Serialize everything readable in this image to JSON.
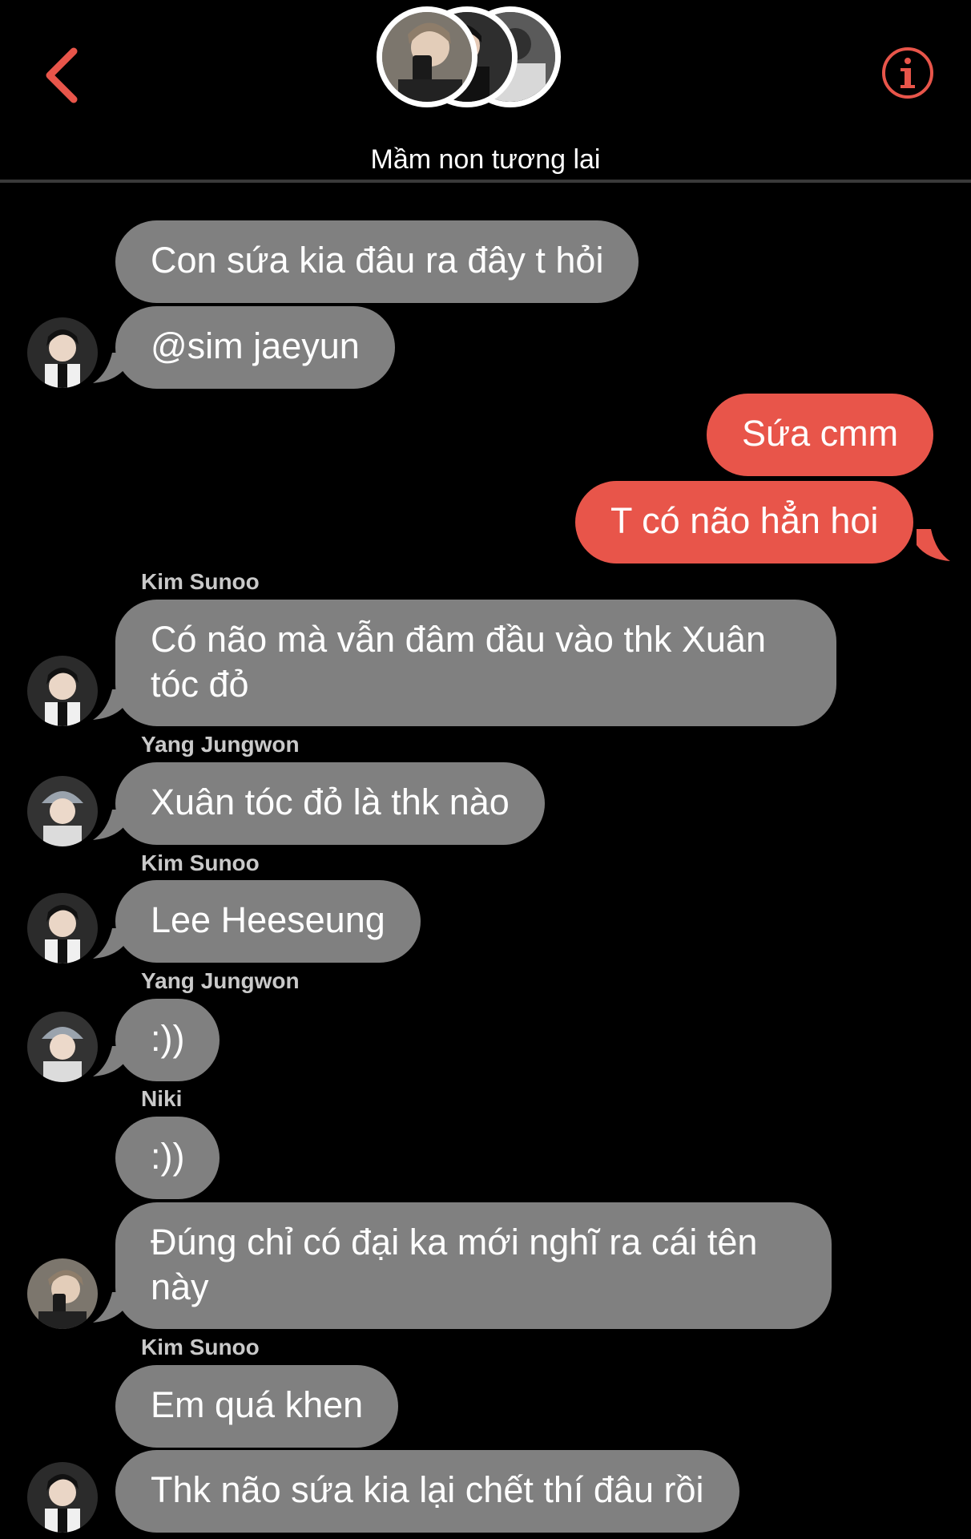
{
  "header": {
    "title": "Mầm non tương lai",
    "accent_color": "#e8554a",
    "back_icon": "chevron-left-icon",
    "info_icon": "info-circle-icon"
  },
  "messages": {
    "m1": "Con sứa kia đâu ra đây t hỏi",
    "m2": "@sim jaeyun",
    "m3": "Sứa cmm",
    "m4": "T có não hẳn hoi",
    "s5": "Kim Sunoo",
    "m5_l1": "Có não mà vẫn đâm đầu vào thk Xuân",
    "m5_l2": "tóc đỏ",
    "s6": "Yang Jungwon",
    "m6": "Xuân tóc đỏ là thk nào",
    "s7": "Kim Sunoo",
    "m7": "Lee Heeseung",
    "s8": "Yang Jungwon",
    "m8": ":))",
    "s9": "Niki",
    "m9": ":))",
    "m10_l1": "Đúng chỉ có đại ka mới nghĩ ra cái tên",
    "m10_l2": "này",
    "s11": "Kim Sunoo",
    "m11": "Em quá khen",
    "m12": "Thk não sứa kia lại chết thí đâu rồi"
  },
  "colors": {
    "incoming_bubble": "#808080",
    "outgoing_bubble": "#e8554a",
    "background": "#000000"
  }
}
